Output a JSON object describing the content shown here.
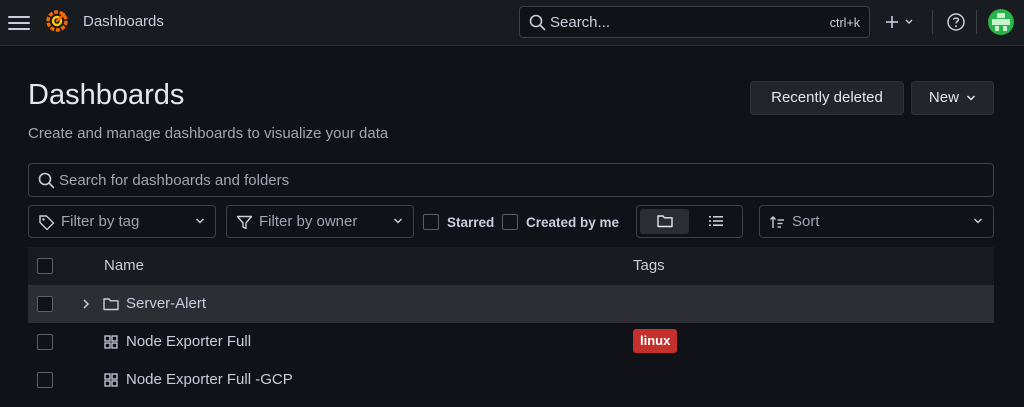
{
  "topbar": {
    "breadcrumb": "Dashboards",
    "search_placeholder": "Search...",
    "search_shortcut": "ctrl+k"
  },
  "page": {
    "title": "Dashboards",
    "subtitle": "Create and manage dashboards to visualize your data",
    "recently_deleted_label": "Recently deleted",
    "new_label": "New"
  },
  "search": {
    "placeholder": "Search for dashboards and folders"
  },
  "filters": {
    "tag_placeholder": "Filter by tag",
    "owner_placeholder": "Filter by owner",
    "starred_label": "Starred",
    "created_by_me_label": "Created by me",
    "sort_placeholder": "Sort",
    "view_selected": "folder"
  },
  "table": {
    "headers": {
      "name": "Name",
      "tags": "Tags"
    },
    "rows": [
      {
        "type": "folder",
        "name": "Server-Alert",
        "tags": []
      },
      {
        "type": "dashboard",
        "name": "Node Exporter Full",
        "tags": [
          "linux"
        ]
      },
      {
        "type": "dashboard",
        "name": "Node Exporter Full -GCP",
        "tags": []
      }
    ]
  },
  "colors": {
    "background": "#111217",
    "panel": "#181b1f",
    "row_highlight": "#2c2e33",
    "tag_linux": "#c4302b",
    "brand_orange": "#f46800"
  },
  "icons": {
    "menu": "hamburger-icon",
    "logo": "grafana-logo",
    "search": "search-icon",
    "add": "plus-icon",
    "help": "help-circle-icon",
    "avatar": "user-avatar",
    "tag": "tag-icon",
    "owner": "filter-icon",
    "sort": "sort-icon",
    "folder": "folder-icon",
    "list": "list-icon",
    "dashboard": "dashboard-grid-icon",
    "expand": "chevron-right-icon"
  }
}
